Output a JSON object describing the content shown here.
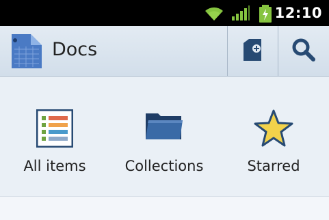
{
  "status_bar": {
    "time": "12:10",
    "icons": [
      "wifi-icon",
      "signal-icon",
      "battery-charging-icon"
    ]
  },
  "action_bar": {
    "title": "Docs",
    "app_icon": "docs-app-icon",
    "buttons": [
      {
        "name": "new-document-icon"
      },
      {
        "name": "search-icon"
      }
    ]
  },
  "main": {
    "tiles": [
      {
        "label": "All items",
        "icon": "list-icon"
      },
      {
        "label": "Collections",
        "icon": "folder-icon"
      },
      {
        "label": "Starred",
        "icon": "star-icon"
      }
    ]
  },
  "colors": {
    "status_bar_bg": "#000000",
    "action_bar_bg": "#d8e3ee",
    "icon_blue": "#274a73",
    "star_fill": "#f2d24b",
    "wifi_green": "#86c440"
  }
}
